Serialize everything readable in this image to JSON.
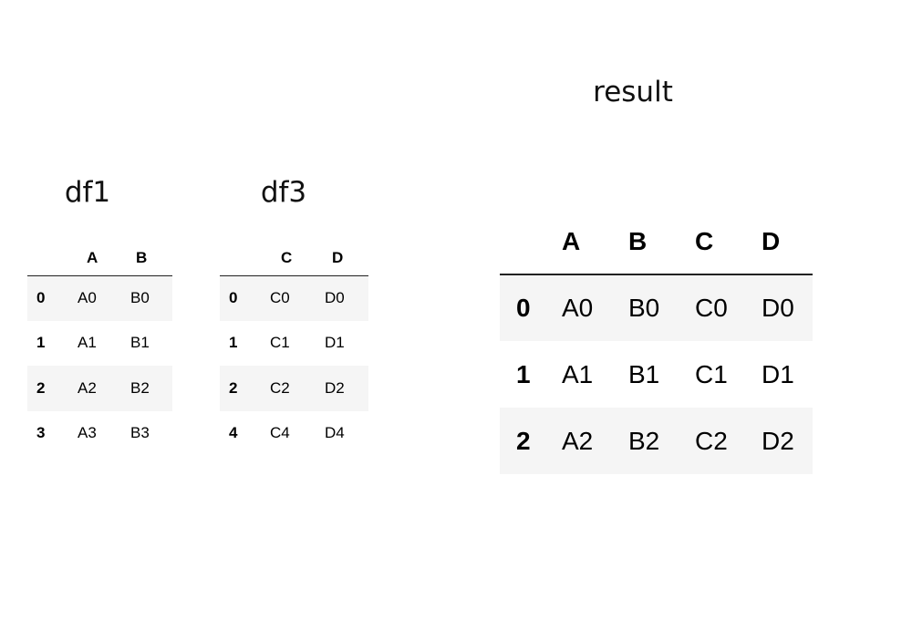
{
  "tables": {
    "df1": {
      "title": "df1",
      "columns": [
        "A",
        "B"
      ],
      "rows": [
        {
          "index": "0",
          "cells": [
            "A0",
            "B0"
          ]
        },
        {
          "index": "1",
          "cells": [
            "A1",
            "B1"
          ]
        },
        {
          "index": "2",
          "cells": [
            "A2",
            "B2"
          ]
        },
        {
          "index": "3",
          "cells": [
            "A3",
            "B3"
          ]
        }
      ]
    },
    "df3": {
      "title": "df3",
      "columns": [
        "C",
        "D"
      ],
      "rows": [
        {
          "index": "0",
          "cells": [
            "C0",
            "D0"
          ]
        },
        {
          "index": "1",
          "cells": [
            "C1",
            "D1"
          ]
        },
        {
          "index": "2",
          "cells": [
            "C2",
            "D2"
          ]
        },
        {
          "index": "4",
          "cells": [
            "C4",
            "D4"
          ]
        }
      ]
    },
    "result": {
      "title": "result",
      "columns": [
        "A",
        "B",
        "C",
        "D"
      ],
      "rows": [
        {
          "index": "0",
          "cells": [
            "A0",
            "B0",
            "C0",
            "D0"
          ]
        },
        {
          "index": "1",
          "cells": [
            "A1",
            "B1",
            "C1",
            "D1"
          ]
        },
        {
          "index": "2",
          "cells": [
            "A2",
            "B2",
            "C2",
            "D2"
          ]
        }
      ]
    }
  },
  "colors": {
    "stripe": "#f5f5f5",
    "header_rule": "#222222"
  }
}
